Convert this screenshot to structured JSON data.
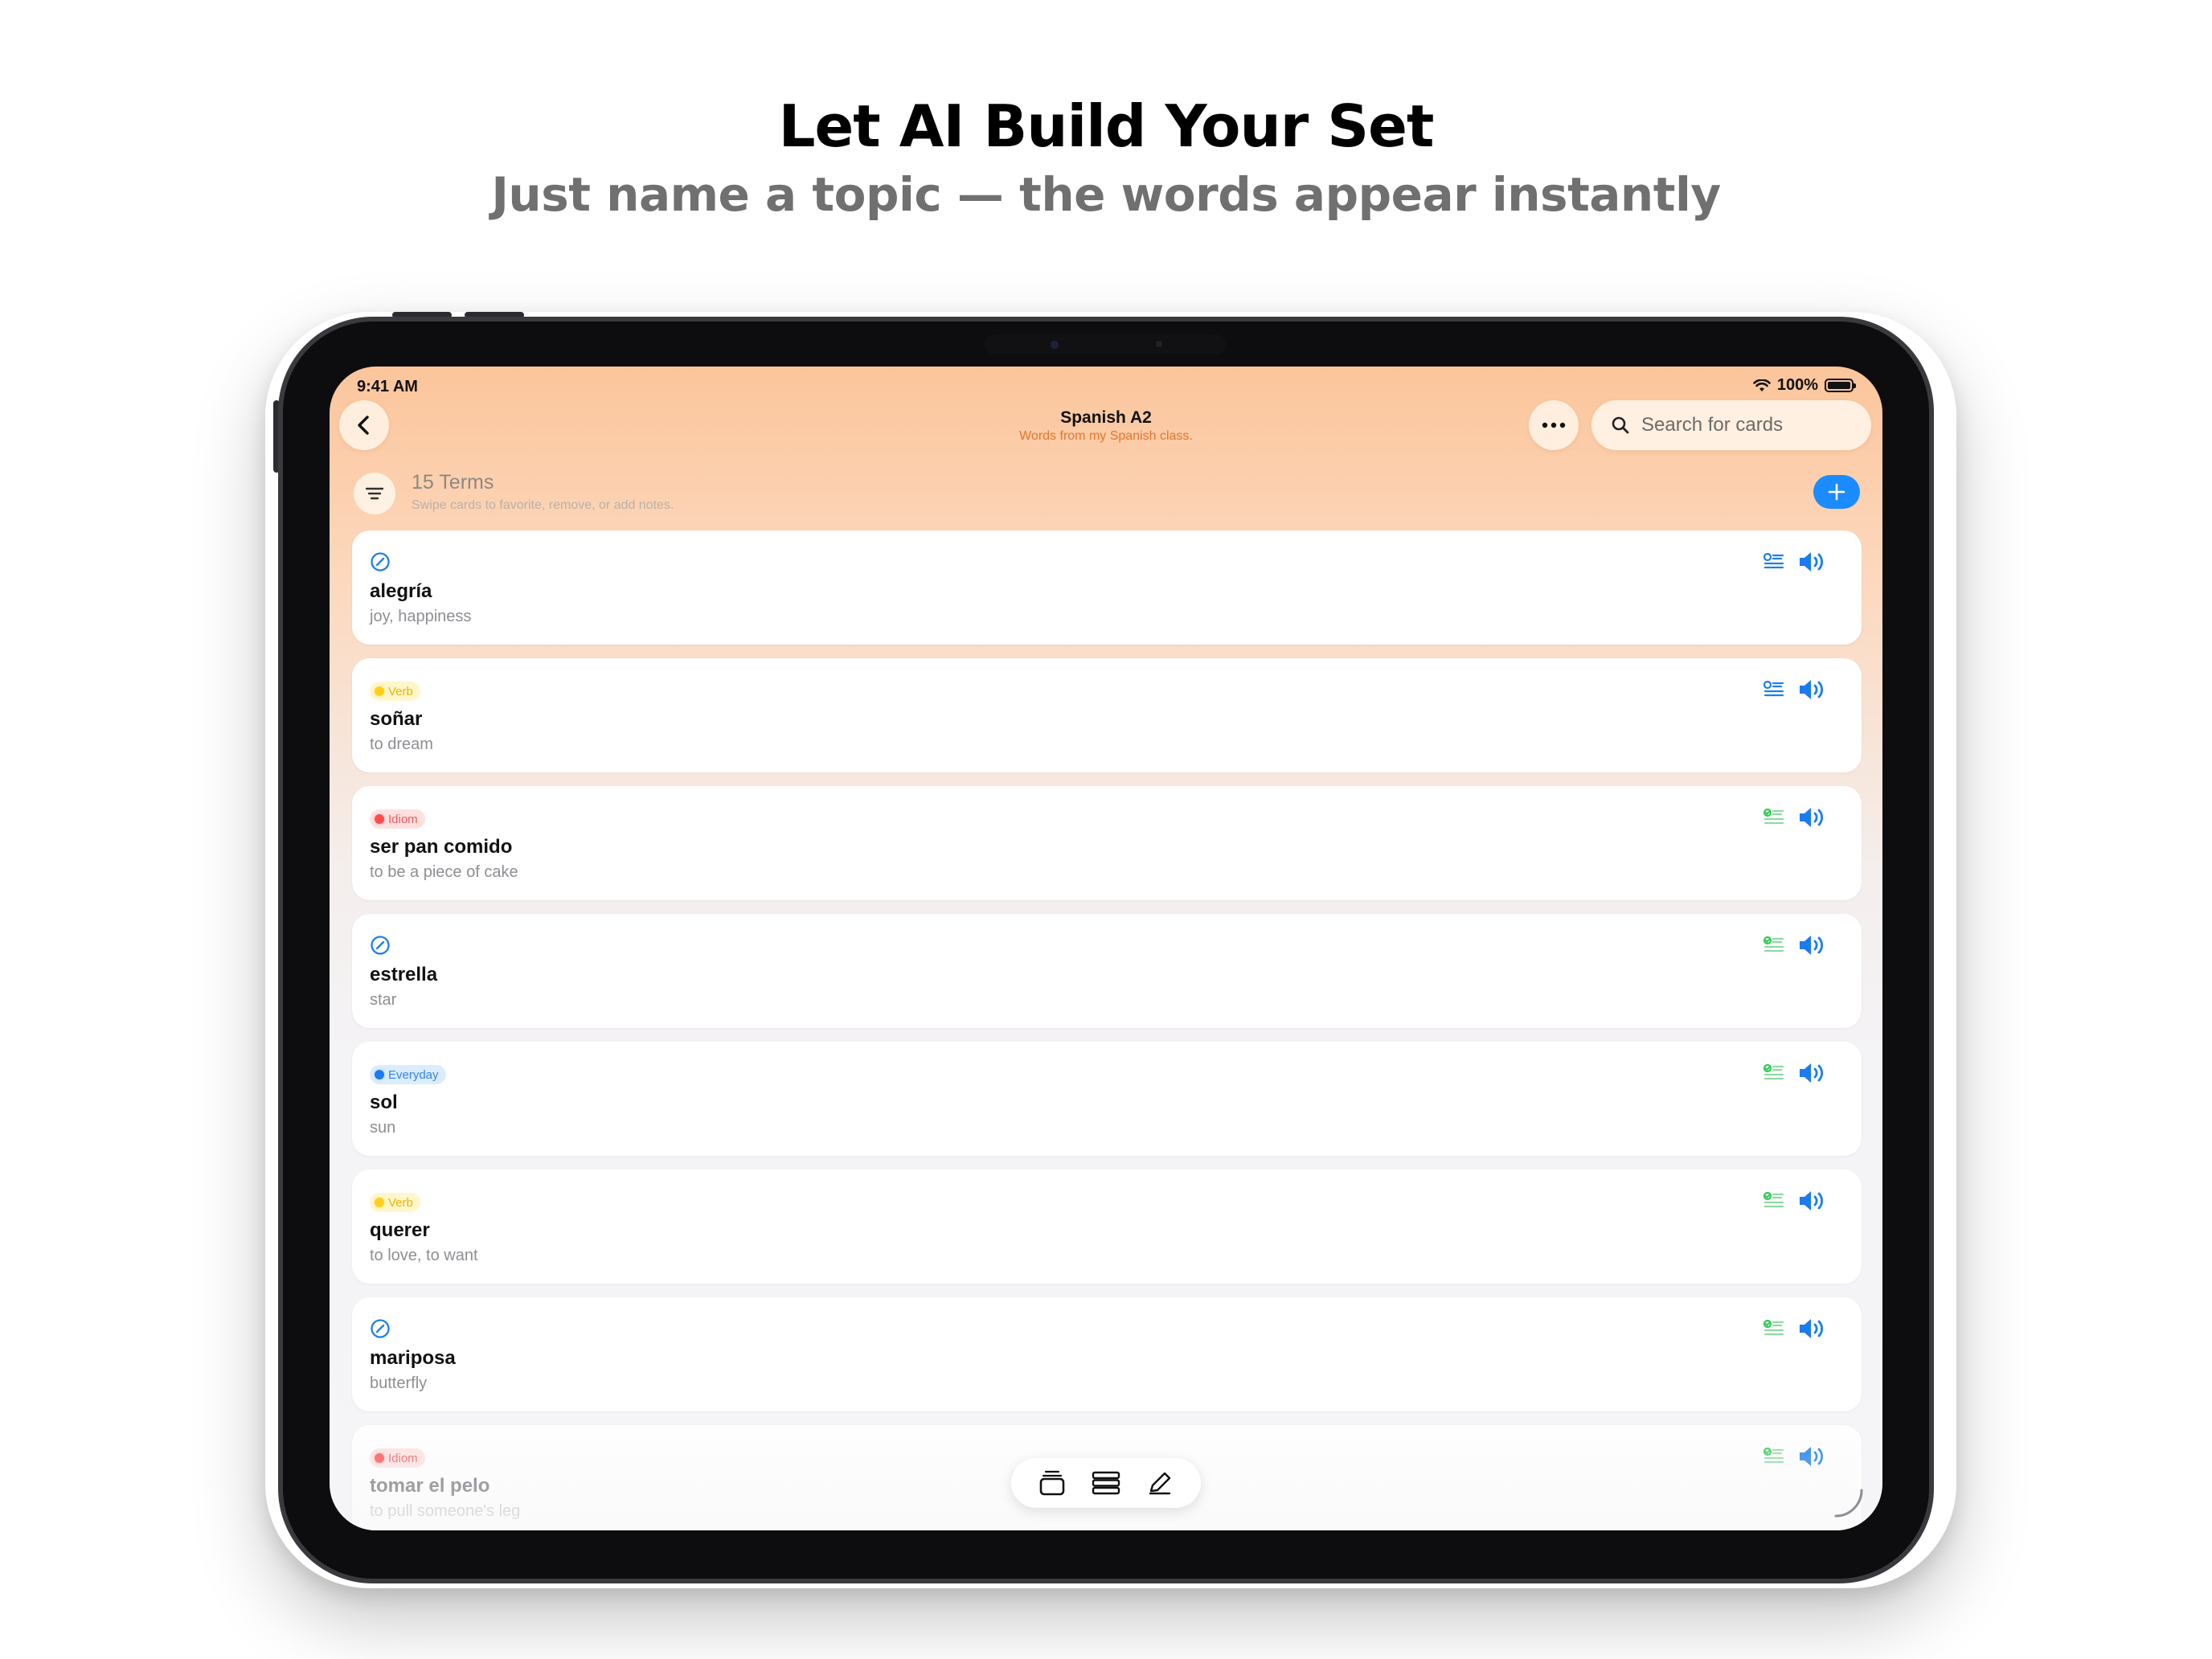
{
  "headline": "Let AI Build Your Set",
  "subheadline": "Just name a topic — the words appear instantly",
  "status": {
    "time": "9:41 AM",
    "battery": "100%"
  },
  "nav": {
    "title": "Spanish A2",
    "subtitle": "Words from my Spanish class.",
    "search_placeholder": "Search for cards"
  },
  "list_header": {
    "count": "15 Terms",
    "hint": "Swipe cards to favorite, remove, or add notes."
  },
  "colors": {
    "accent": "#1a8cff",
    "subtitle_orange": "#e3772d"
  },
  "cards": [
    {
      "tag": "",
      "tag_type": "none",
      "term": "alegría",
      "definition": "joy, happiness",
      "list_icon": "blue"
    },
    {
      "tag": "Verb",
      "tag_type": "verb",
      "term": "soñar",
      "definition": "to dream",
      "list_icon": "blue"
    },
    {
      "tag": "Idiom",
      "tag_type": "idiom",
      "term": "ser pan comido",
      "definition": "to be a piece of cake",
      "list_icon": "green"
    },
    {
      "tag": "",
      "tag_type": "none",
      "term": "estrella",
      "definition": "star",
      "list_icon": "green"
    },
    {
      "tag": "Everyday",
      "tag_type": "everyday",
      "term": "sol",
      "definition": "sun",
      "list_icon": "green"
    },
    {
      "tag": "Verb",
      "tag_type": "verb",
      "term": "querer",
      "definition": "to love, to want",
      "list_icon": "green"
    },
    {
      "tag": "",
      "tag_type": "none",
      "term": "mariposa",
      "definition": "butterfly",
      "list_icon": "green"
    },
    {
      "tag": "Idiom",
      "tag_type": "idiom",
      "term": "tomar el pelo",
      "definition": "to pull someone's leg",
      "list_icon": "green"
    }
  ],
  "icons": {
    "back": "chevron-left-icon",
    "more": "ellipsis-icon",
    "search": "magnifier-icon",
    "filter": "filter-lines-icon",
    "add": "plus-icon",
    "untagged": "slashed-circle-icon",
    "mastery": "list-check-icon",
    "speaker": "speaker-icon",
    "toolbar": [
      "cards-stack-icon",
      "list-view-icon",
      "edit-pencil-icon"
    ]
  }
}
